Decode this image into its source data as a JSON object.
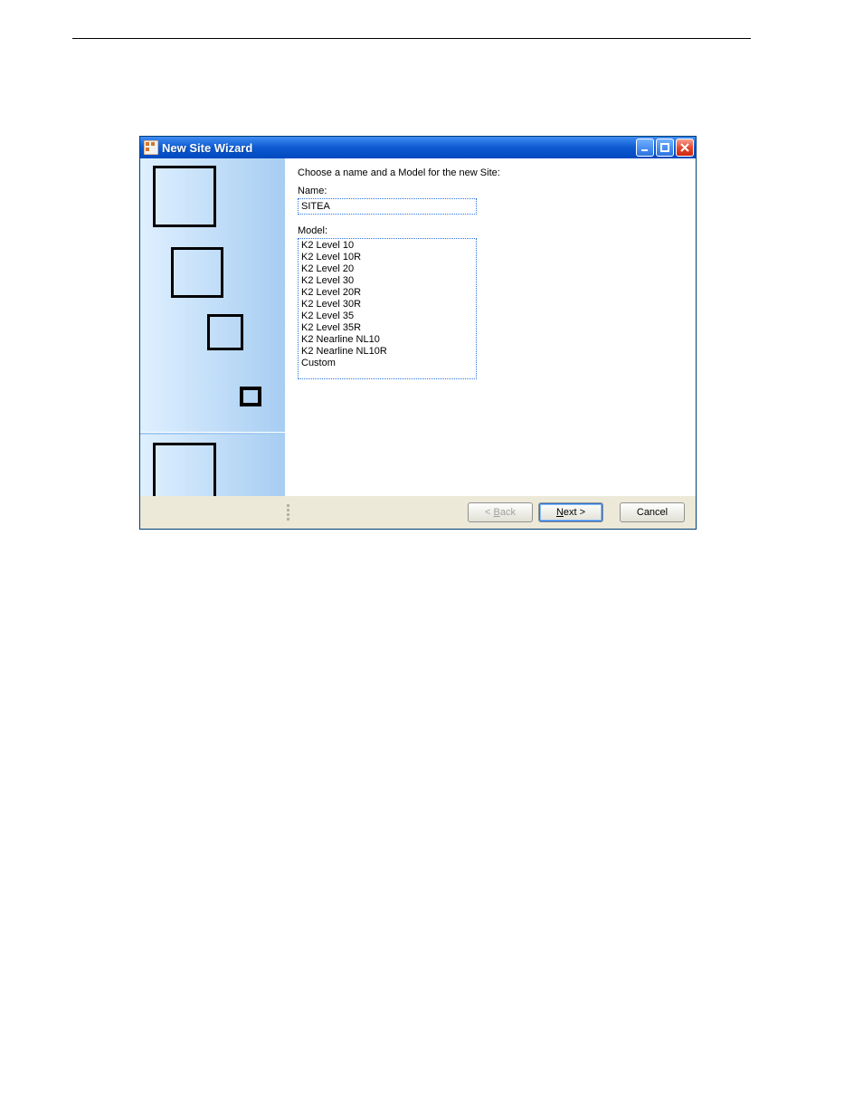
{
  "window": {
    "title": "New Site Wizard"
  },
  "content": {
    "prompt": "Choose a name and a Model for the new Site:",
    "name_label": "Name:",
    "name_value": "SITEA",
    "model_label": "Model:",
    "models": [
      "K2 Level 10",
      "K2 Level 10R",
      "K2 Level 20",
      "K2 Level 30",
      "K2 Level 20R",
      "K2 Level 30R",
      "K2 Level 35",
      "K2 Level 35R",
      "K2 Nearline NL10",
      "K2 Nearline NL10R",
      "Custom"
    ]
  },
  "buttons": {
    "back_prefix": "< ",
    "back_access": "B",
    "back_suffix": "ack",
    "next_access": "N",
    "next_suffix": "ext >",
    "cancel": "Cancel"
  }
}
